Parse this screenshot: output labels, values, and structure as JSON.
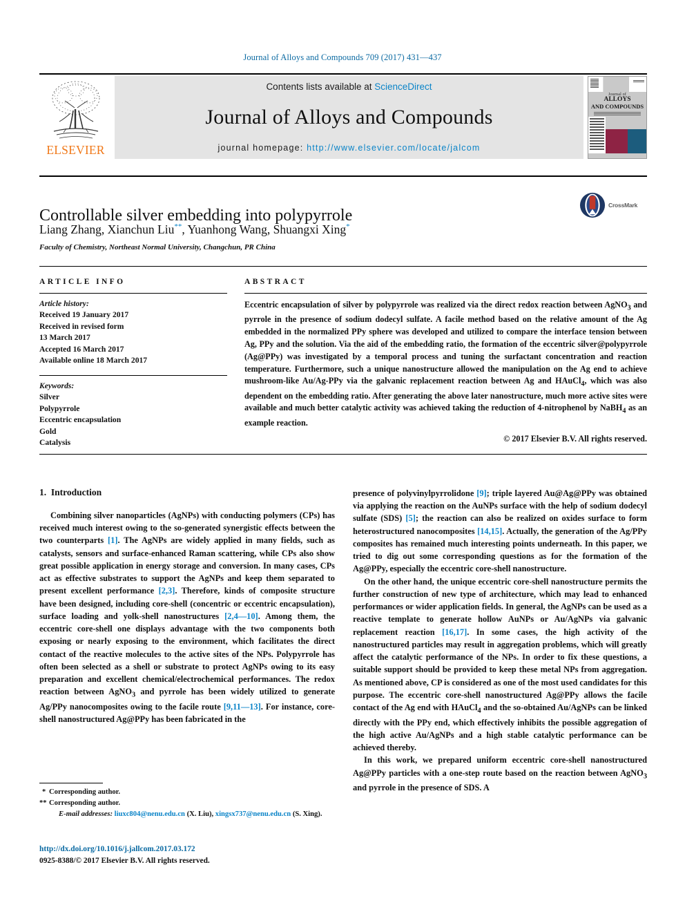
{
  "running_head": "Journal of Alloys and Compounds 709 (2017) 431—437",
  "masthead": {
    "contents_prefix": "Contents lists available at ",
    "sciencedirect": "ScienceDirect",
    "journal_name": "Journal of Alloys and Compounds",
    "homepage_prefix": "journal homepage: ",
    "homepage_url": "http://www.elsevier.com/locate/jalcom",
    "publisher": "ELSEVIER",
    "cover": {
      "line1": "Journal of",
      "line2": "ALLOYS",
      "line3": "AND COMPOUNDS"
    }
  },
  "article": {
    "title": "Controllable silver embedding into polypyrrole",
    "authors_part1": "Liang Zhang, Xianchun Liu",
    "authors_mark1": "**",
    "authors_part2": ", Yuanhong Wang, Shuangxi Xing",
    "authors_mark2": "*",
    "affiliation": "Faculty of Chemistry, Northeast Normal University, Changchun, PR China",
    "crossmark_label": "CrossMark"
  },
  "info": {
    "heading": "ARTICLE INFO",
    "history_label": "Article history:",
    "history": [
      "Received 19 January 2017",
      "Received in revised form",
      "13 March 2017",
      "Accepted 16 March 2017",
      "Available online 18 March 2017"
    ],
    "keywords_label": "Keywords:",
    "keywords": [
      "Silver",
      "Polypyrrole",
      "Eccentric encapsulation",
      "Gold",
      "Catalysis"
    ]
  },
  "abstract": {
    "heading": "ABSTRACT",
    "text": "Eccentric encapsulation of silver by polypyrrole was realized via the direct redox reaction between AgNO3 and pyrrole in the presence of sodium dodecyl sulfate. A facile method based on the relative amount of the Ag embedded in the normalized PPy sphere was developed and utilized to compare the interface tension between Ag, PPy and the solution. Via the aid of the embedding ratio, the formation of the eccentric silver@polypyrrole (Ag@PPy) was investigated by a temporal process and tuning the surfactant concentration and reaction temperature. Furthermore, such a unique nanostructure allowed the manipulation on the Ag end to achieve mushroom-like Au/Ag-PPy via the galvanic replacement reaction between Ag and HAuCl4, which was also dependent on the embedding ratio. After generating the above later nanostructure, much more active sites were available and much better catalytic activity was achieved taking the reduction of 4-nitrophenol by NaBH4 as an example reaction.",
    "copyright": "© 2017 Elsevier B.V. All rights reserved."
  },
  "body": {
    "section_number": "1.",
    "section_title": "Introduction",
    "left_paragraphs": [
      "Combining silver nanoparticles (AgNPs) with conducting polymers (CPs) has received much interest owing to the so-generated synergistic effects between the two counterparts [1]. The AgNPs are widely applied in many fields, such as catalysts, sensors and surface-enhanced Raman scattering, while CPs also show great possible application in energy storage and conversion. In many cases, CPs act as effective substrates to support the AgNPs and keep them separated to present excellent performance [2,3]. Therefore, kinds of composite structure have been designed, including core-shell (concentric or eccentric encapsulation), surface loading and yolk-shell nanostructures [2,4—10]. Among them, the eccentric core-shell one displays advantage with the two components both exposing or nearly exposing to the environment, which facilitates the direct contact of the reactive molecules to the active sites of the NPs. Polypyrrole has often been selected as a shell or substrate to protect AgNPs owing to its easy preparation and excellent chemical/electrochemical performances. The redox reaction between AgNO3 and pyrrole has been widely utilized to generate Ag/PPy nanocomposites owing to the facile route [9,11—13]. For instance, core-shell nanostructured Ag@PPy has been fabricated in the"
    ],
    "right_paragraphs": [
      "presence of polyvinylpyrrolidone [9]; triple layered Au@Ag@PPy was obtained via applying the reaction on the AuNPs surface with the help of sodium dodecyl sulfate (SDS) [5]; the reaction can also be realized on oxides surface to form heterostructured nanocomposites [14,15]. Actually, the generation of the Ag/PPy composites has remained much interesting points underneath. In this paper, we tried to dig out some corresponding questions as for the formation of the Ag@PPy, especially the eccentric core-shell nanostructure.",
      "On the other hand, the unique eccentric core-shell nanostructure permits the further construction of new type of architecture, which may lead to enhanced performances or wider application fields. In general, the AgNPs can be used as a reactive template to generate hollow AuNPs or Au/AgNPs via galvanic replacement reaction [16,17]. In some cases, the high activity of the nanostructured particles may result in aggregation problems, which will greatly affect the catalytic performance of the NPs. In order to fix these questions, a suitable support should be provided to keep these metal NPs from aggregation. As mentioned above, CP is considered as one of the most used candidates for this purpose. The eccentric core-shell nanostructured Ag@PPy allows the facile contact of the Ag end with HAuCl4 and the so-obtained Au/AgNPs can be linked directly with the PPy end, which effectively inhibits the possible aggregation of the high active Au/AgNPs and a high stable catalytic performance can be achieved thereby.",
      "In this work, we prepared uniform eccentric core-shell nanostructured Ag@PPy particles with a one-step route based on the reaction between AgNO3 and pyrrole in the presence of SDS. A"
    ]
  },
  "footnotes": {
    "corresponding1_mark": "*",
    "corresponding1": "Corresponding author.",
    "corresponding2_mark": "**",
    "corresponding2": "Corresponding author.",
    "email_label": "E-mail addresses:",
    "email1": "liuxc804@nenu.edu.cn",
    "email1_owner": "(X. Liu),",
    "email2": "xingsx737@nenu.edu.cn",
    "email2_owner": "(S. Xing)."
  },
  "doi": {
    "url": "http://dx.doi.org/10.1016/j.jallcom.2017.03.172",
    "issn_line": "0925-8388/© 2017 Elsevier B.V. All rights reserved."
  }
}
